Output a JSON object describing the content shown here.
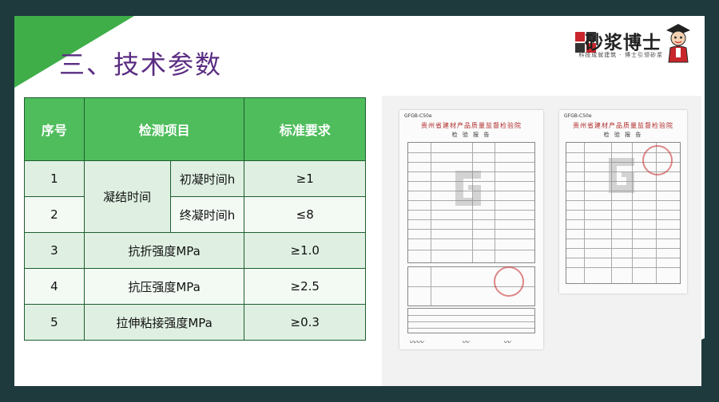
{
  "slide": {
    "title": "三、技术参数",
    "brand_name": "砂浆博士",
    "brand_slogan": "科技成就建筑 · 博士引领砂浆"
  },
  "table": {
    "headers": [
      "序号",
      "检测项目",
      "标准要求"
    ],
    "group_label": "凝结时间",
    "rows": [
      {
        "no": "1",
        "item": "初凝时间h",
        "req": "≥1"
      },
      {
        "no": "2",
        "item": "终凝时间h",
        "req": "≤8"
      },
      {
        "no": "3",
        "item": "抗折强度MPa",
        "req": "≥1.0"
      },
      {
        "no": "4",
        "item": "抗压强度MPa",
        "req": "≥2.5"
      },
      {
        "no": "5",
        "item": "拉伸粘接强度MPa",
        "req": "≥0.3"
      }
    ]
  },
  "documents": [
    {
      "code": "GFGB-C50e",
      "issuer": "贵州省建材产品质量监督检验院",
      "title": "检 验 报 告"
    },
    {
      "code": "GFGB-C50e",
      "issuer": "贵州省建材产品质量监督检验院",
      "title": "检 验 报 告"
    }
  ],
  "colors": {
    "title": "#5a2c82",
    "header_green": "#4fbd5c",
    "row_light": "#dff0e2",
    "row_lighter": "#f3faf4",
    "frame": "#1f3a3d",
    "corner_green": "#3fae49"
  }
}
